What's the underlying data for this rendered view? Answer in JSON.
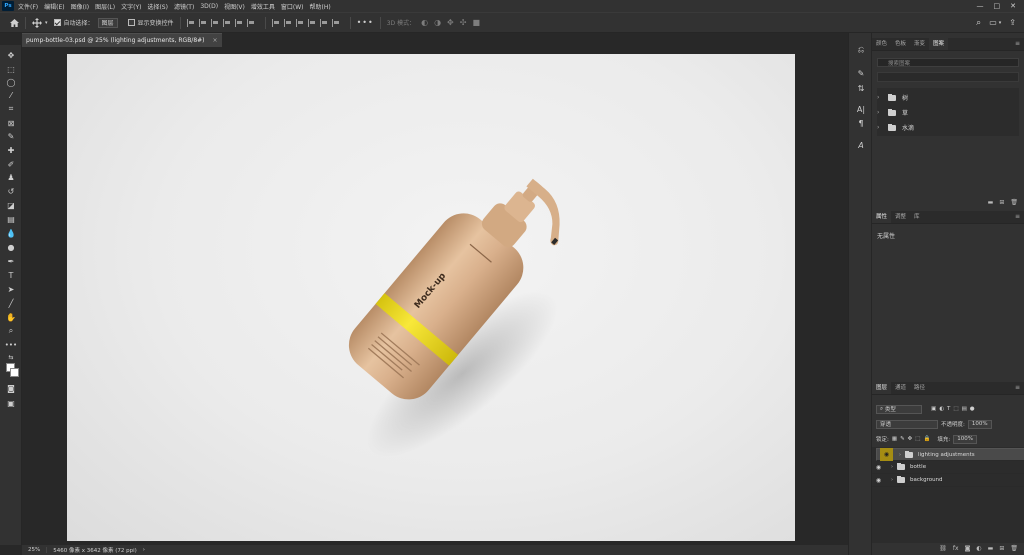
{
  "app": {
    "logo": "Ps"
  },
  "menu": [
    "文件(F)",
    "编辑(E)",
    "图像(I)",
    "图层(L)",
    "文字(Y)",
    "选择(S)",
    "滤镜(T)",
    "3D(D)",
    "视图(V)",
    "增效工具",
    "窗口(W)",
    "帮助(H)"
  ],
  "window_controls": [
    "—",
    "□",
    "✕"
  ],
  "options": {
    "auto_select_label": "自动选择：",
    "auto_select_value": "图层",
    "show_transform_label": "显示变换控件",
    "mode_label": "3D 模式："
  },
  "document": {
    "tab_title": "pump-bottle-03.psd @ 25% (lighting adjustments, RGB/8#)",
    "close": "×"
  },
  "status": {
    "zoom": "25%",
    "doc_info": "5460 像素 x 3642 像素 (72 ppi)",
    "arrow": "›"
  },
  "libraries_panel": {
    "tabs": [
      "颜色",
      "色板",
      "渐变",
      "图案"
    ],
    "active_tab": "图案",
    "search_placeholder": "搜索图案",
    "items": [
      {
        "name": "树"
      },
      {
        "name": "草"
      },
      {
        "name": "水滴"
      }
    ]
  },
  "properties_panel": {
    "tabs": [
      "属性",
      "调整",
      "库"
    ],
    "active_tab": "属性",
    "empty_text": "无属性"
  },
  "layers_panel": {
    "tabs": [
      "图层",
      "通道",
      "路径"
    ],
    "active_tab": "图层",
    "filter_label": "类型",
    "blend_mode": "穿透",
    "opacity_label": "不透明度:",
    "opacity_value": "100%",
    "lock_label": "锁定:",
    "fill_label": "填充:",
    "fill_value": "100%",
    "layers": [
      {
        "name": "lighting adjustments",
        "selected": true
      },
      {
        "name": "bottle",
        "selected": false
      },
      {
        "name": "background",
        "selected": false
      }
    ]
  },
  "artwork": {
    "label_main": "Mock-up"
  },
  "colors": {
    "accent_layer": "#a58d13",
    "band_yellow": "#f3e01a",
    "bottle": "#d9b08c"
  }
}
